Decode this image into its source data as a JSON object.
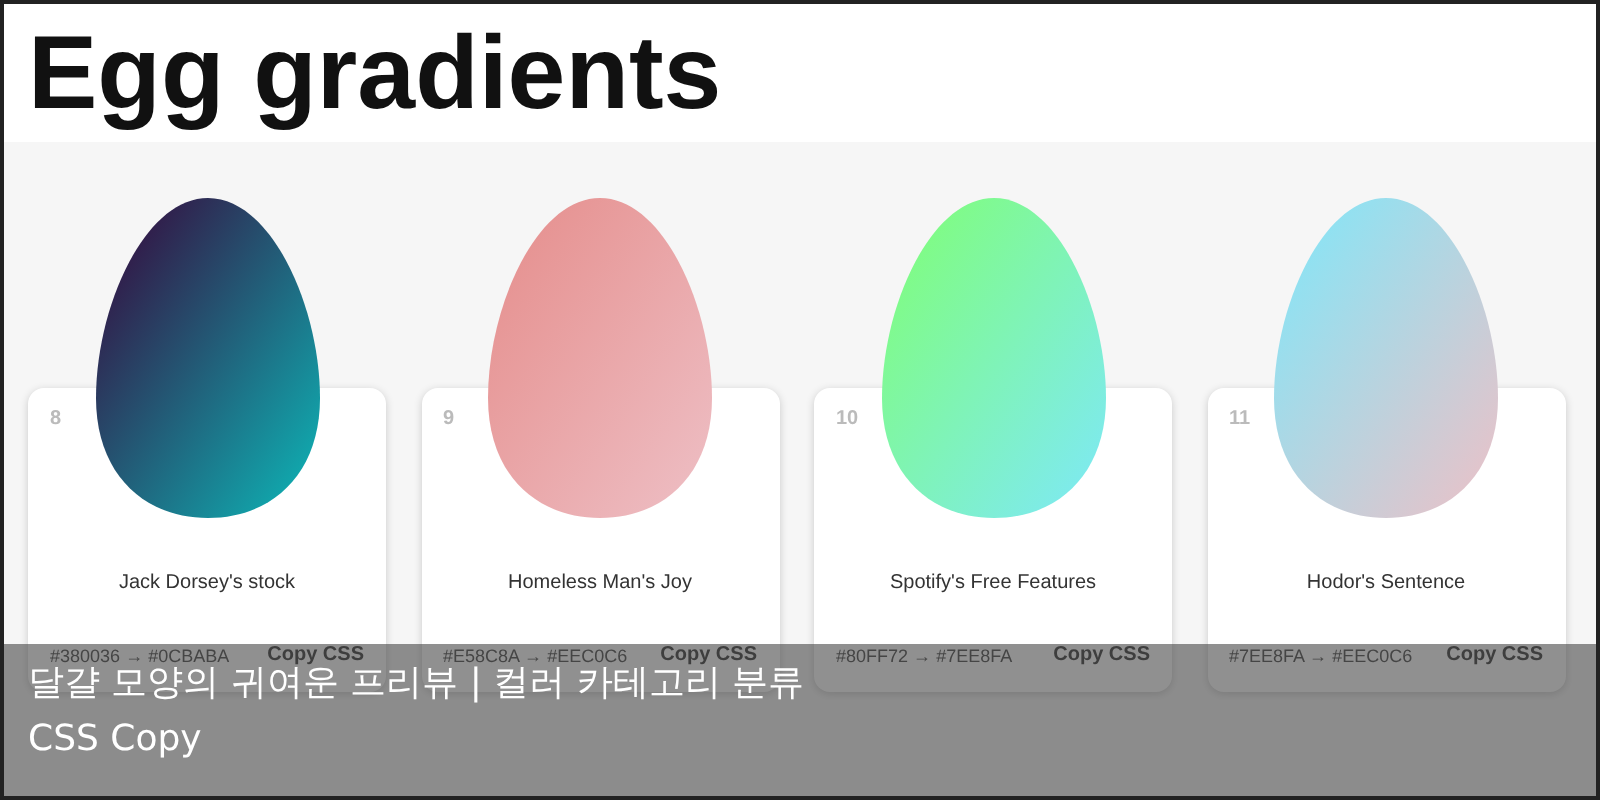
{
  "title": "Egg gradients",
  "eggs": [
    {
      "number": "8",
      "name": "Jack Dorsey's stock",
      "from": "#380036",
      "arrow": "→",
      "to": "#0CBABA",
      "copy": "Copy CSS"
    },
    {
      "number": "9",
      "name": "Homeless Man's Joy",
      "from": "#E58C8A",
      "arrow": "→",
      "to": "#EEC0C6",
      "copy": "Copy CSS"
    },
    {
      "number": "10",
      "name": "Spotify's Free Features",
      "from": "#80FF72",
      "arrow": "→",
      "to": "#7EE8FA",
      "copy": "Copy CSS"
    },
    {
      "number": "11",
      "name": "Hodor's Sentence",
      "from": "#7EE8FA",
      "arrow": "→",
      "to": "#EEC0C6",
      "copy": "Copy CSS"
    }
  ],
  "caption": {
    "line_1": "달걀 모양의 귀여운 프리뷰 | 컬러 카테고리 분류",
    "line_2": "CSS Copy"
  }
}
